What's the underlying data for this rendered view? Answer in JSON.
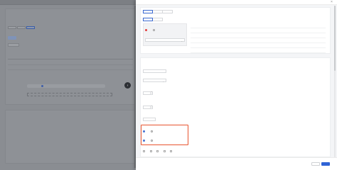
{
  "background": {
    "breadcrumb": [
      "",
      "",
      ""
    ],
    "card1": {
      "title": "",
      "desc": "",
      "tabs": [
        "",
        "",
        ""
      ],
      "field_label": "",
      "pill": "",
      "table_header": "",
      "table_row_a": "",
      "table_row_b": "",
      "slider_label": "",
      "add_label": ""
    },
    "card2": {
      "title": "",
      "field_label": "",
      "field_value": ""
    }
  },
  "drawer": {
    "title": "",
    "close": "×",
    "section1": {
      "tabs": [
        "",
        "",
        ""
      ],
      "label_a": "",
      "source_label": "",
      "radio_a": "",
      "radio_b": "",
      "select_label": "",
      "kv": [
        {
          "key": "",
          "value": ""
        },
        {
          "key": "",
          "value": ""
        },
        {
          "key": "",
          "value": ""
        },
        {
          "key": "",
          "value": ""
        },
        {
          "key": "",
          "value": ""
        },
        {
          "key": "",
          "value": ""
        }
      ]
    },
    "section2": {
      "title": "",
      "field1_label": "",
      "field2_label": "",
      "field3_label": "",
      "field3_note": "",
      "field3_value": "",
      "field4_label": "",
      "field4_note": "",
      "field4_value": "",
      "field5_label": "",
      "field5_note": "",
      "highlight_label1": "",
      "highlight_radio_a": "",
      "highlight_radio_b": "",
      "highlight_label2": "",
      "highlight_radio_c": "",
      "highlight_radio_d": "",
      "bottom_label": "",
      "checkboxes": [
        "",
        "",
        "",
        "",
        ""
      ]
    },
    "footer": {
      "cancel": "",
      "ok": ""
    }
  },
  "colors": {
    "primary": "#2f63d6",
    "danger": "#e23b3b",
    "highlight": "#e8542f"
  }
}
